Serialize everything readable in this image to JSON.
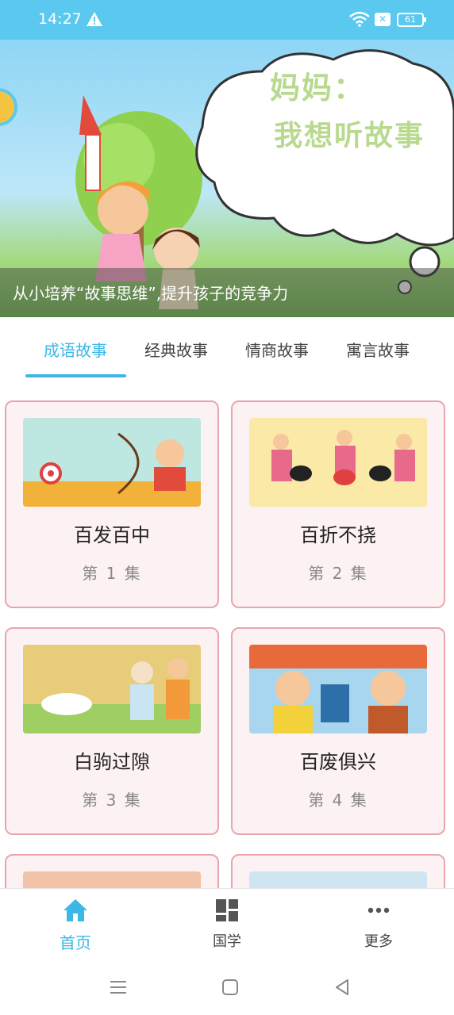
{
  "status_bar": {
    "time": "14:27",
    "battery": "61",
    "icons": [
      "warning-icon",
      "wifi-icon",
      "close-box-icon",
      "battery-icon"
    ]
  },
  "banner": {
    "title": "妈妈：",
    "subtitle": "我想听故事",
    "caption": "从小培养“故事思维”,提升孩子的竞争力"
  },
  "tabs": [
    {
      "label": "成语故事",
      "active": true
    },
    {
      "label": "经典故事",
      "active": false
    },
    {
      "label": "情商故事",
      "active": false
    },
    {
      "label": "寓言故事",
      "active": false
    }
  ],
  "cards": [
    {
      "title": "百发百中",
      "episode": "第 1 集"
    },
    {
      "title": "百折不挠",
      "episode": "第 2 集"
    },
    {
      "title": "白驹过隙",
      "episode": "第 3 集"
    },
    {
      "title": "百废俱兴",
      "episode": "第 4 集"
    }
  ],
  "bottom_nav": [
    {
      "label": "首页",
      "icon": "home-icon",
      "active": true
    },
    {
      "label": "国学",
      "icon": "grid-icon",
      "active": false
    },
    {
      "label": "更多",
      "icon": "more-dots-icon",
      "active": false
    }
  ],
  "system_nav": [
    "menu-icon",
    "home-square-icon",
    "back-triangle-icon"
  ],
  "colors": {
    "accent": "#3db7e4",
    "status_bar": "#5bc8ef",
    "card_bg": "#fdf2f3",
    "card_border": "#e8a6aa"
  }
}
